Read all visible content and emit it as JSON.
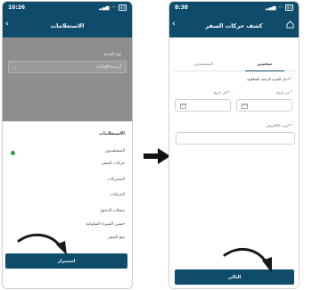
{
  "left_screen": {
    "status": {
      "time": "10:26",
      "battery": "40"
    },
    "title": "الاستعلامات",
    "field_label": "نوع الخدمة",
    "field_value": "أرصدة الإجازات",
    "sheet": {
      "title": "الاستعلامات",
      "options": [
        "المستفيدون",
        "حركات السفر",
        "المشركات",
        "المركبات",
        "سجلات الدخول",
        "حسين السيرة السلوكية",
        "منع السفر"
      ],
      "selected_index": 0
    },
    "button_label": "استمرار"
  },
  "right_screen": {
    "status": {
      "time": "8:38",
      "battery": "84"
    },
    "title": "كشف حركات السفر",
    "tabs": [
      "شخصي",
      "المستفيدون"
    ],
    "active_tab": 0,
    "section_label": "أدخل الفترة الزمنية المطلوبة",
    "from_label": "من تاريخ",
    "to_label": "الى تاريخ",
    "email_label": "البريد الالكتروني",
    "button_label": "التالي"
  },
  "colors": {
    "header": "#0f4c6b",
    "selected": "#2e9b4f",
    "required": "#e04b4b"
  }
}
